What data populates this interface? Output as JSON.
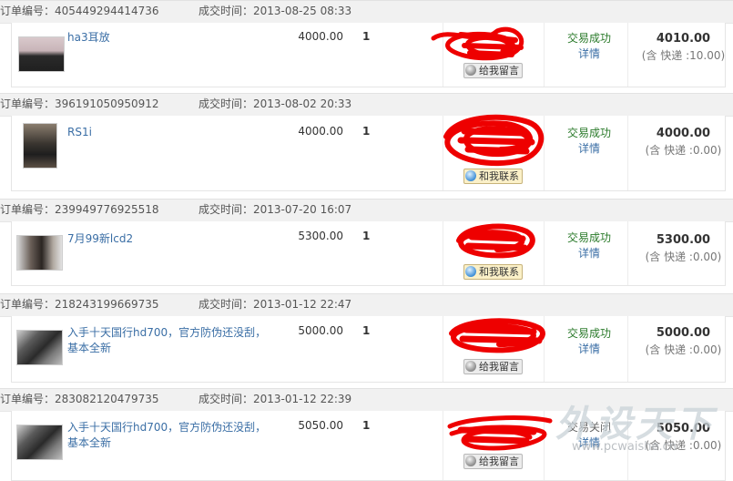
{
  "labels": {
    "order_no": "订单编号：",
    "deal_time": "成交时间："
  },
  "orders": [
    {
      "order_no": "405449294414736",
      "deal_time": "2013-08-25 08:33",
      "item": "ha3耳放",
      "price": "4000.00",
      "qty": "1",
      "contact": "给我留言",
      "status": "交易成功",
      "detail": "详情",
      "total": "4010.00",
      "shipping": "(含 快递 :10.00)"
    },
    {
      "order_no": "396191050950912",
      "deal_time": "2013-08-02 20:33",
      "item": "RS1i",
      "price": "4000.00",
      "qty": "1",
      "contact": "和我联系",
      "status": "交易成功",
      "detail": "详情",
      "total": "4000.00",
      "shipping": "(含 快递 :0.00)"
    },
    {
      "order_no": "239949776925518",
      "deal_time": "2013-07-20 16:07",
      "item": "7月99新lcd2",
      "price": "5300.00",
      "qty": "1",
      "contact": "和我联系",
      "status": "交易成功",
      "detail": "详情",
      "total": "5300.00",
      "shipping": "(含 快递 :0.00)"
    },
    {
      "order_no": "218243199669735",
      "deal_time": "2013-01-12 22:47",
      "item": "入手十天国行hd700，官方防伪还没刮，基本全新",
      "price": "5000.00",
      "qty": "1",
      "contact": "给我留言",
      "status": "交易成功",
      "detail": "详情",
      "total": "5000.00",
      "shipping": "(含 快递 :0.00)"
    },
    {
      "order_no": "283082120479735",
      "deal_time": "2013-01-12 22:39",
      "item": "入手十天国行hd700，官方防伪还没刮，基本全新",
      "price": "5050.00",
      "qty": "1",
      "contact": "给我留言",
      "status": "交易关闭",
      "detail": "详情",
      "total": "5050.00",
      "shipping": "(含 快递 :0.00)"
    }
  ],
  "watermark": {
    "brand": "外设天下",
    "url": "www.pcwaishe.cn"
  },
  "colors": {
    "link": "#3a6ea5",
    "success": "#2a7a2a",
    "scribble": "#ee0000"
  }
}
